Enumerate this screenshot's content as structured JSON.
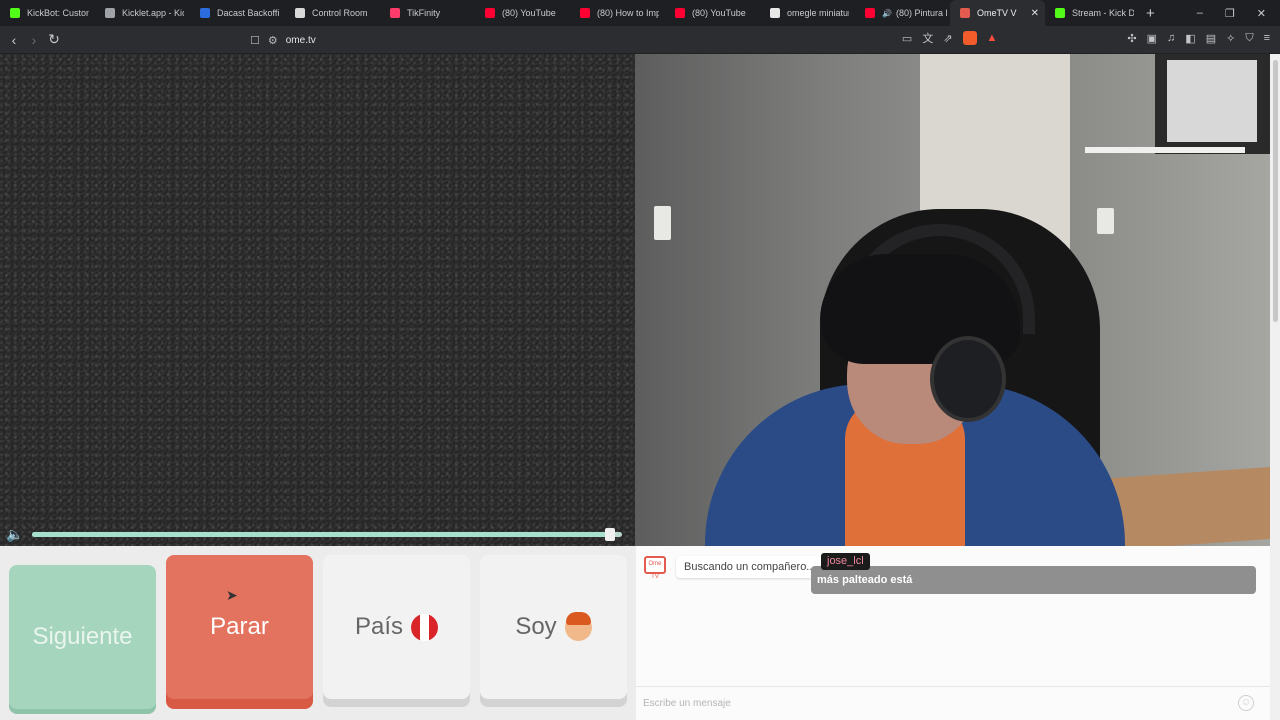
{
  "tabs": [
    {
      "label": "KickBot: Customiz",
      "color": "#53fc18"
    },
    {
      "label": "Kicklet.app - Kick",
      "color": "#9fa3a8"
    },
    {
      "label": "Dacast Backoffice",
      "color": "#2d6cdf"
    },
    {
      "label": "Control Room",
      "color": "#d8d8d8"
    },
    {
      "label": "TikFinity",
      "color": "#ff3b6b"
    },
    {
      "label": "(80) YouTube",
      "color": "#ff0033"
    },
    {
      "label": "(80) How to Impo",
      "color": "#ff0033"
    },
    {
      "label": "(80) YouTube",
      "color": "#ff0033"
    },
    {
      "label": "omegle miniatura",
      "color": "#e8e8e8"
    },
    {
      "label": "(80) Pintura l",
      "color": "#ff0033",
      "audio": true
    },
    {
      "label": "OmeTV V",
      "color": "#e35a4f",
      "active": true,
      "close": "✕"
    },
    {
      "label": "Stream - Kick Da",
      "color": "#53fc18"
    }
  ],
  "newtab": "+",
  "window_controls": [
    "–",
    "❐",
    "✕"
  ],
  "url": "ome.tv",
  "video": {
    "volume_level": 0.98
  },
  "buttons": {
    "next": "Siguiente",
    "stop": "Parar",
    "country": "País",
    "gender": "Soy"
  },
  "chat": {
    "logo": "Ome TV",
    "status": "Buscando un compañero...",
    "username": "jose_lcl",
    "message": "más palteado está",
    "placeholder": "Escribe un mensaje"
  }
}
